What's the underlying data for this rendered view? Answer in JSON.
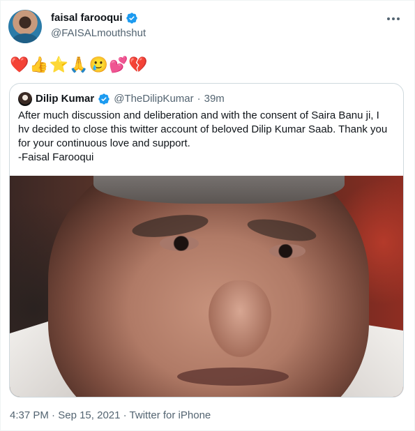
{
  "tweet": {
    "author_name": "faisal farooqui",
    "author_handle": "@FAISALmouthshut",
    "emojis": "❤️👍⭐🙏🥲💕💔",
    "quoted": {
      "name": "Dilip Kumar",
      "handle": "@TheDilipKumar",
      "separator": "·",
      "time": "39m",
      "lines": [
        "After much discussion and deliberation and with the consent of Saira Banu ji, I",
        "hv decided to close this twitter account of beloved Dilip Kumar Saab. Thank you",
        "for your continuous love and support.",
        "-Faisal Farooqui"
      ]
    },
    "timestamp": "4:37 PM",
    "date": "Sep 15, 2021",
    "source": "Twitter for iPhone",
    "meta_separator": "·"
  },
  "colors": {
    "verified": "#1d9bf0",
    "secondary_text": "#536471",
    "border": "#cfd9de"
  },
  "icons": {
    "verified": "verified-badge-icon",
    "more": "more-options-icon"
  }
}
